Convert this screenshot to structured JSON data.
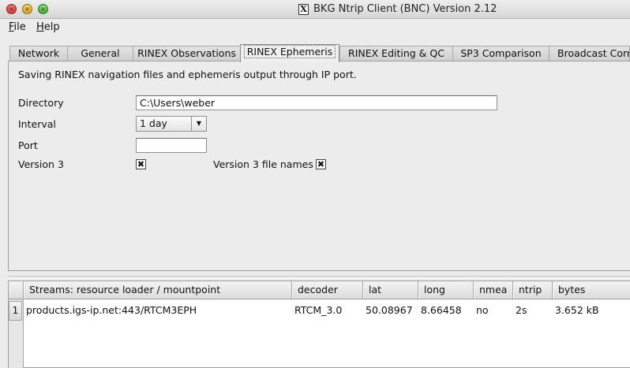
{
  "window": {
    "title": "BKG Ntrip Client (BNC) Version 2.12",
    "x11_icon": "x11-icon"
  },
  "menu": {
    "file_label_key": "F",
    "file_label_rest": "ile",
    "help_label_key": "H",
    "help_label_rest": "elp"
  },
  "tabs": [
    {
      "label": "Network"
    },
    {
      "label": "General"
    },
    {
      "label": "RINEX Observations"
    },
    {
      "label": "RINEX Ephemeris"
    },
    {
      "label": "RINEX Editing & QC"
    },
    {
      "label": "SP3 Comparison"
    },
    {
      "label": "Broadcast Corre"
    }
  ],
  "active_tab": "RINEX Ephemeris",
  "ephemeris": {
    "description": "Saving RINEX navigation files and ephemeris output through IP port.",
    "directory_label": "Directory",
    "directory_value": "C:\\Users\\weber",
    "interval_label": "Interval",
    "interval_value": "1 day",
    "port_label": "Port",
    "port_value": "",
    "version3_label": "Version 3",
    "version3_checked": true,
    "version3_names_label": "Version 3 file names",
    "version3_names_checked": true,
    "check_glyph": "✖"
  },
  "streams": {
    "headers": {
      "mountpoint": "Streams:   resource loader / mountpoint",
      "decoder": "decoder",
      "lat": "lat",
      "long": "long",
      "nmea": "nmea",
      "ntrip": "ntrip",
      "bytes": "bytes"
    },
    "rows": [
      {
        "index": "1",
        "mountpoint": "products.igs-ip.net:443/RTCM3EPH",
        "decoder": "RTCM_3.0",
        "lat": "50.08967",
        "long": "8.66458",
        "nmea": "no",
        "ntrip": "2s",
        "bytes": "3.652 kB"
      }
    ]
  }
}
